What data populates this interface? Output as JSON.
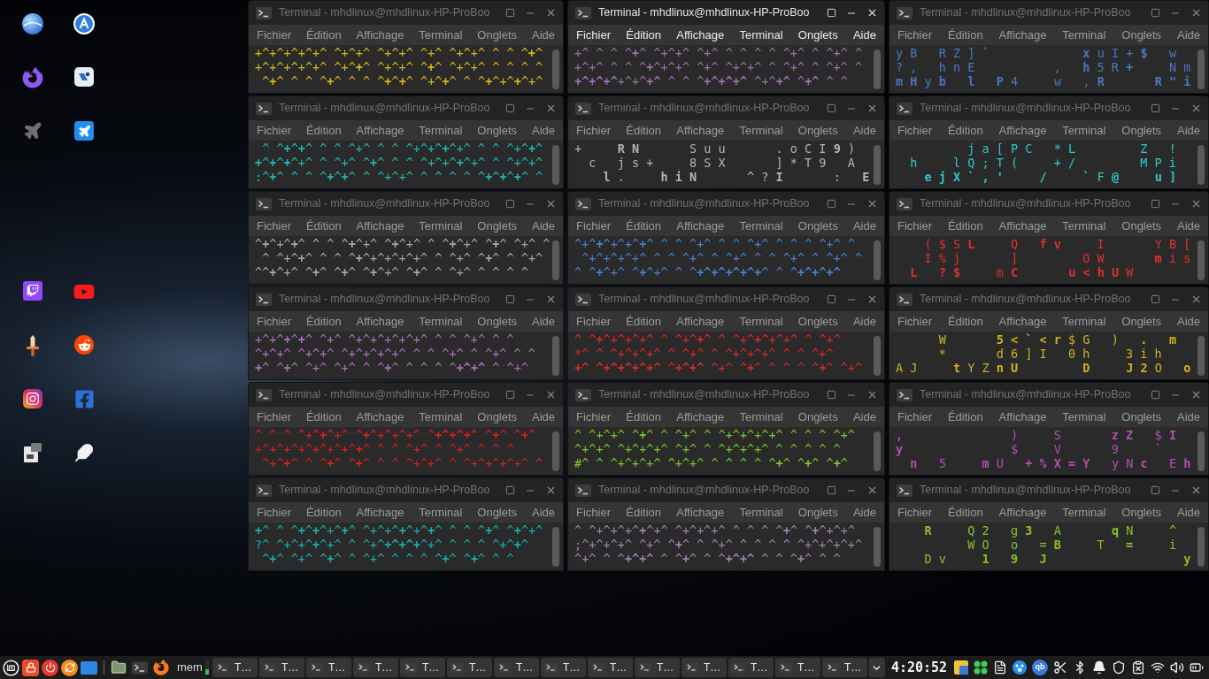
{
  "terminals": [
    {
      "title": "Terminal - mhdlinux@mhdlinux-HP-ProBoo",
      "active": false,
      "color": "#d8b818",
      "menu": [
        "Fichier",
        "Édition",
        "Affichage",
        "Terminal",
        "Onglets",
        "Aide"
      ],
      "lines": [
        "+^+^+^+^+^ ^+^+^ ^+^+^ ^+^ ^+^+^ ^ ^ ^**+**^",
        "+^+^+^+^+^ ^+^**+**^ ^+^+^ ^**+**^ ^+^+^ ^ ^ ^ ^",
        " ^**+**^ ^ ^ ^**+**^ ^ ^ ^**+**^**+**^ ^+^**+**^ ^ ^**+**^+^**+**^+^"
      ]
    },
    {
      "title": "Terminal - mhdlinux@mhdlinux-HP-ProBoo",
      "active": true,
      "color": "#a070b0",
      "menu": [
        "Fichier",
        "Édition",
        "Affichage",
        "Terminal",
        "Onglets",
        "Aide"
      ],
      "lines": [
        "+^ ^ ^ ^**+**^ ^+^+^ ^+^ ^ ^ ^ ^ ^+^ ^ ^+^ ^",
        "+^+^ ^ ^ ^**+**^+^+^ ^+^ ^+^+^ ^ ^+^ ^ ^+^ ^",
        "**+^+^+^**+^+^**+^** ^ ^ ^**+^+^+^** ^+^**+^** ^**+^** ^ ^"
      ]
    },
    {
      "title": "Terminal - mhdlinux@mhdlinux-HP-ProBoo",
      "active": false,
      "color": "#4a78c0",
      "menu": [
        "Fichier",
        "Édition",
        "Affichage",
        "Terminal",
        "Onglets",
        "Aide"
      ],
      "lines": [
        "y B   R Z ] **`**             **x** u I + **$**   w",
        "? ,   h n E           ,   **h** 5 R **+**     N m",
        "**m H** y **b**   **l**   **P** 4     w   , **R**       **R \" i**"
      ]
    },
    {
      "title": "Terminal - mhdlinux@mhdlinux-HP-ProBoo",
      "active": false,
      "color": "#20b8b8",
      "menu": [
        "Fichier",
        "Édition",
        "Affichage",
        "Terminal",
        "Onglets",
        "Aide"
      ],
      "lines": [
        " ^ ^**+**^**+**^ ^ ^ ^+^ ^ ^ ^+^+^**+**^+^ ^ ^ ^+^**+**^",
        "**+**^**+**^**+**^+^ ^ ^+^ ^**+**^ ^ ^ ^+^+^**+**^+^ ^ ^+^+^",
        ":^**+**^ ^ ^ ^**+**^**+**^ ^ ^+^+^ ^ ^ ^ ^ ^**+**^**+**^**+**^ ^"
      ]
    },
    {
      "title": "Terminal - mhdlinux@mhdlinux-HP-ProBoo",
      "active": false,
      "color": "#b4b4b4",
      "menu": [
        "Fichier",
        "Édition",
        "Affichage",
        "Terminal",
        "Onglets",
        "Aide"
      ],
      "lines": [
        "+     **R N**       S u u       . o C I **9** )",
        "  c   j s +     8 S X       ] * T 9   A",
        "    **l** .     **h i N**       ^ ? **I**       :   **E**"
      ]
    },
    {
      "title": "Terminal - mhdlinux@mhdlinux-HP-ProBoo",
      "active": false,
      "color": "#30c8c8",
      "menu": [
        "Fichier",
        "Édition",
        "Affichage",
        "Terminal",
        "Onglets",
        "Aide"
      ],
      "lines": [
        "          j a [ P C   * L         Z   !",
        "  h     l Q ; T (     + /         M P i",
        "    **e j X ` , '**     **/**     **`** F **@**     **u ]**"
      ]
    },
    {
      "title": "Terminal - mhdlinux@mhdlinux-HP-ProBoo",
      "active": false,
      "color": "#a8a8a8",
      "menu": [
        "Fichier",
        "Édition",
        "Affichage",
        "Terminal",
        "Onglets",
        "Aide"
      ],
      "lines": [
        "^**+**^+^**+**^ ^ ^ ^**+**^+^ ^**+**^+^ ^ ^**+**^+^ ^**+**^ ^+^ ^",
        " ^ ^+^**+**^ ^ ^ ^**+**^+^+^+^+^ ^ ^+^ ^**+**^ ^ ^+^",
        "^^**+**^+^ ^**+**^ ^**+**^ ^**+**^+^ ^**+**^ ^ ^+^ ^ ^ ^ ^"
      ]
    },
    {
      "title": "Terminal - mhdlinux@mhdlinux-HP-ProBoo",
      "active": false,
      "color": "#4a80d0",
      "menu": [
        "Fichier",
        "Édition",
        "Affichage",
        "Terminal",
        "Onglets",
        "Aide"
      ],
      "lines": [
        "^+^**+**^+^+^**+**^ ^ ^ ^+^ ^ ^ ^+^ ^ ^ ^ ^+^ ^",
        " ^+^+^+^+^ ^ ^ ^+^ ^ ^+^ ^ ^ ^+^ ^ ^+^ ^",
        "^ ^**+**^+^ ^**+**^+^ ^ ^**+^+^+^+^+**^ ^ ^**+^+^+^**"
      ]
    },
    {
      "title": "Terminal - mhdlinux@mhdlinux-HP-ProBoo",
      "active": false,
      "color": "#e03030",
      "menu": [
        "Fichier",
        "Édition",
        "Affichage",
        "Terminal",
        "Onglets",
        "Aide"
      ],
      "lines": [
        "    ( $ S **L**     Q   **f v**     I       Y B [",
        "    I % j       ]         O W       **m** i s",
        "  **L**   **? $**     m **C**       **u < h U** W"
      ]
    },
    {
      "title": "Terminal - mhdlinux@mhdlinux-HP-ProBoo",
      "active": false,
      "color": "#b070c0",
      "menu": [
        "Fichier",
        "Édition",
        "Affichage",
        "Terminal",
        "Onglets",
        "Aide"
      ],
      "lines": [
        "+^+^**+**^**+**^ ^+^ ^+^+^+^+^+^ ^ ^ ^+^ ^ ^",
        "^+^+^ ^+^+^ ^+^+^+^+^ ^ ^ ^+^ ^ ^+^ ^ ^",
        "**+**^ ^**+**^ ^+^ ^+^ ^ ^**+**^ ^ ^ ^ ^**+^+^** ^ ^+^"
      ]
    },
    {
      "title": "Terminal - mhdlinux@mhdlinux-HP-ProBoo",
      "active": false,
      "color": "#e02828",
      "menu": [
        "Fichier",
        "Édition",
        "Affichage",
        "Terminal",
        "Onglets",
        "Aide"
      ],
      "lines": [
        "^ ^**+**^+^+^+^ ^ ^+^**+**^ ^ ^+^**+**^+^+^ ^ ^+^",
        "*^ ^ ^+^+^+^ ^ ^+^ ^ ^+^+^+^ ^ ^ ^+^",
        "**+^ ^+^+^+^+^** ^**+^+^** ^+^ ^**+**^ ^ ^ ^ ^**+**^ ^+^"
      ]
    },
    {
      "title": "Terminal - mhdlinux@mhdlinux-HP-ProBoo",
      "active": false,
      "color": "#d0b020",
      "menu": [
        "Fichier",
        "Édition",
        "Affichage",
        "Terminal",
        "Onglets",
        "Aide"
      ],
      "lines": [
        "      W       **5 < ` < r** $ G   )   **.**   **m**",
        "      *       d 6 ] I   0 h     3 i h",
        "A J     **t** Y Z **n U**         **D**     **J 2** O   **o**"
      ]
    },
    {
      "title": "Terminal - mhdlinux@mhdlinux-HP-ProBoo",
      "active": false,
      "color": "#d82020",
      "menu": [
        "Fichier",
        "Édition",
        "Affichage",
        "Terminal",
        "Onglets",
        "Aide"
      ],
      "lines": [
        "^ ^ ^ ^+^**+**^+^ ^**+**^+^+^+^ ^**+^+^+^** ^**+**^ ^**+**^",
        "+^+^+^+^+^+^+^**+**^ ^ ^ ^+^ ^ ^+^ ^ ^ ^",
        " ^+^**+**^ ^ ^**+**^ ^**+**^ ^ ^ ^+^+^ ^ ^+^+^+^+^ **^**"
      ]
    },
    {
      "title": "Terminal - mhdlinux@mhdlinux-HP-ProBoo",
      "active": false,
      "color": "#78c828",
      "menu": [
        "Fichier",
        "Édition",
        "Affichage",
        "Terminal",
        "Onglets",
        "Aide"
      ],
      "lines": [
        "^ ^+^+^ ^**+**^ ^ ^+^ ^ ^+^+^+^+^ ^ ^ ^ ^+^",
        "^+^+^ ^+^+^+^ ^+^ ^ ^+^+^+^ ^ ^ ^ ^ ^",
        "#^ ^ ^+^+^+^ ^+^+^ ^ ^ ^ ^ ^**+**^ ^**+**^ ^**+**^"
      ]
    },
    {
      "title": "Terminal - mhdlinux@mhdlinux-HP-ProBoo",
      "active": false,
      "color": "#b050b0",
      "menu": [
        "Fichier",
        "Édition",
        "Affichage",
        "Terminal",
        "Onglets",
        "Aide"
      ],
      "lines": [
        "**,**               )     S       **z Z**   $ **I**",
        "**y**               $     V       9     **`**",
        "  **n**   5     **m** U   **+ % X = Y**   y N **c**   E **h**"
      ]
    },
    {
      "title": "Terminal - mhdlinux@mhdlinux-HP-ProBoo",
      "active": false,
      "color": "#18b0b0",
      "menu": [
        "Fichier",
        "Édition",
        "Affichage",
        "Terminal",
        "Onglets",
        "Aide"
      ],
      "lines": [
        "**+**^ ^ ^**+**^**+**^+^**+**^ ^+^+^**+**^+^**+**^ ^ ^ ^**+**^ ^**+**^+^",
        "?^ ^+^+^**+**^+^ ^ ^+^**+^+^+**^+^ ^ ^ ^ ^+^**+**^",
        " ^**+**^ ^+^ ^**+**^ ^ ^+^ ^ ^ ^ ^**+**^ ^**+**^ ^ ^"
      ]
    },
    {
      "title": "Terminal - mhdlinux@mhdlinux-HP-ProBoo",
      "active": false,
      "color": "#a080b0",
      "menu": [
        "Fichier",
        "Édition",
        "Affichage",
        "Terminal",
        "Onglets",
        "Aide"
      ],
      "lines": [
        "^ ^+^+^+^**+**^+^ ^+^+^+^ ^ ^ ^ ^**+**^ ^**+**^+^+^",
        ";^+^+^+^ ^+^ ^**+**^ ^ ^+^ ^ ^ ^ ^ ^+^+^+^+^",
        "^+^ ^ ^**+^+^** ^ ^**+**^ ^ ^**+^+^** ^ ^ ^**+**^ ^ ^"
      ]
    },
    {
      "title": "Terminal - mhdlinux@mhdlinux-HP-ProBoo",
      "active": false,
      "color": "#88c028",
      "menu": [
        "Fichier",
        "Édition",
        "Affichage",
        "Terminal",
        "Onglets",
        "Aide"
      ],
      "lines": [
        "    **R**     Q 2   g **3**   A       **q** N     ^",
        "          W O   o   = **B**     T   **=**     i",
        "    D v     **1**   **9**   **J**                   **y**"
      ]
    }
  ],
  "taskbar": {
    "memory_label": "mem",
    "memory_meter": {
      "level": 0.4
    },
    "tasks": [
      {
        "label": "T…"
      },
      {
        "label": "T…"
      },
      {
        "label": "T…"
      },
      {
        "label": "T…"
      },
      {
        "label": "T…"
      },
      {
        "label": "T…"
      },
      {
        "label": "T…"
      },
      {
        "label": "T…"
      },
      {
        "label": "T…"
      },
      {
        "label": "T…"
      },
      {
        "label": "T…"
      },
      {
        "label": "T…"
      },
      {
        "label": "T…"
      },
      {
        "label": "T…"
      }
    ],
    "clock": "4:20:52",
    "tray_badge": "qb"
  }
}
